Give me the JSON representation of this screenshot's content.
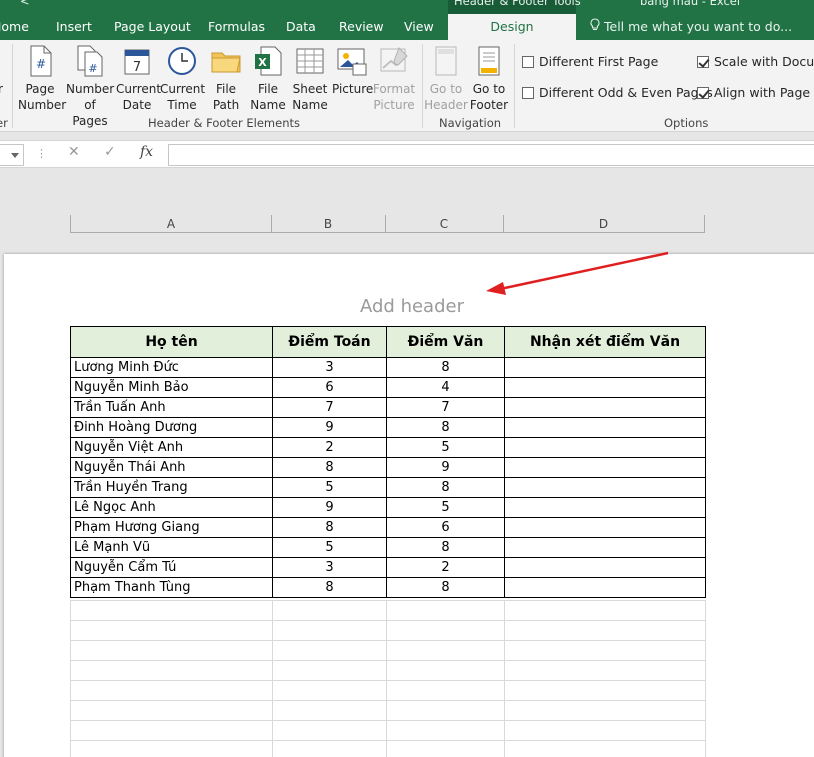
{
  "tabs": {
    "home": "Home",
    "insert": "Insert",
    "page_layout": "Page Layout",
    "formulas": "Formulas",
    "data": "Data",
    "review": "Review",
    "view": "View",
    "design": "Design",
    "context_title": "Header & Footer Tools",
    "doc_title": "bang mau - Excel",
    "tell_me": "Tell me what you want to do..."
  },
  "ribbon": {
    "left_cut_top": "r",
    "left_cut_bottom": "er",
    "buttons": {
      "page_number": [
        "Page",
        "Number"
      ],
      "number_of_pages": [
        "Number",
        "of Pages"
      ],
      "current_date": [
        "Current",
        "Date"
      ],
      "current_time": [
        "Current",
        "Time"
      ],
      "file_path": [
        "File",
        "Path"
      ],
      "file_name": [
        "File",
        "Name"
      ],
      "sheet_name": [
        "Sheet",
        "Name"
      ],
      "picture": [
        "Picture",
        ""
      ],
      "format_picture": [
        "Format",
        "Picture"
      ],
      "go_to_header": [
        "Go to",
        "Header"
      ],
      "go_to_footer": [
        "Go to",
        "Footer"
      ]
    },
    "group_elements": "Header & Footer Elements",
    "group_navigation": "Navigation",
    "group_options": "Options",
    "options": {
      "different_first_page": "Different First Page",
      "different_odd_even": "Different Odd & Even Pages",
      "scale_with_document": "Scale with Docume",
      "align_with_margins": "Align with Page Ma"
    }
  },
  "formula_bar": {
    "cancel": "✕",
    "enter": "✓",
    "fx": "fx"
  },
  "columns": [
    "A",
    "B",
    "C",
    "D"
  ],
  "page": {
    "add_header": "Add header"
  },
  "sheet": {
    "headers": [
      "Họ tên",
      "Điểm Toán",
      "Điểm Văn",
      "Nhận xét điểm Văn"
    ],
    "rows": [
      [
        "Lương Minh Đức",
        "3",
        "8",
        ""
      ],
      [
        "Nguyễn Minh Bảo",
        "6",
        "4",
        ""
      ],
      [
        "Trần Tuấn Anh",
        "7",
        "7",
        ""
      ],
      [
        "Đinh Hoàng Dương",
        "9",
        "8",
        ""
      ],
      [
        "Nguyễn Việt Anh",
        "2",
        "5",
        ""
      ],
      [
        "Nguyễn Thái Anh",
        "8",
        "9",
        ""
      ],
      [
        "Trần Huyền Trang",
        "5",
        "8",
        ""
      ],
      [
        "Lê Ngọc Anh",
        "9",
        "5",
        ""
      ],
      [
        "Phạm Hương Giang",
        "8",
        "6",
        ""
      ],
      [
        "Lê Mạnh Vũ",
        "5",
        "8",
        ""
      ],
      [
        "Nguyễn Cẩm Tú",
        "3",
        "2",
        ""
      ],
      [
        "Phạm Thanh Tùng",
        "8",
        "8",
        ""
      ]
    ]
  },
  "colors": {
    "excel_green": "#217346",
    "header_fill": "#e2efda",
    "arrow": "#e02020"
  }
}
